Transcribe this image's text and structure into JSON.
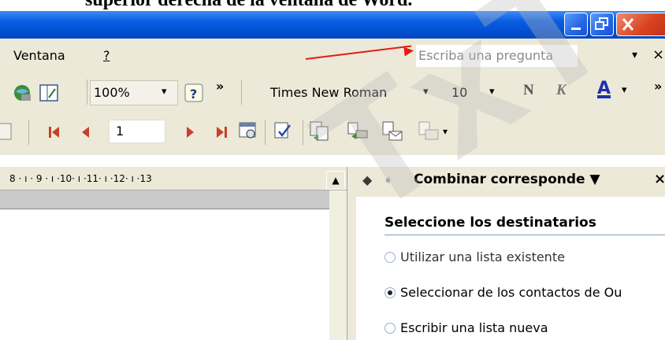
{
  "caption": {
    "text": "superior derecha de la ventana de Word."
  },
  "window": {
    "buttons": [
      {
        "name": "minimize-button",
        "glyph": "_"
      },
      {
        "name": "restore-button",
        "glyph": "❐"
      },
      {
        "name": "close-window-button",
        "glyph": "✕"
      }
    ]
  },
  "menubar": {
    "items": [
      "Ventana",
      "?"
    ],
    "ask_placeholder": "Escriba una pregunta",
    "ask_dropdown": "▾",
    "ask_close": "×",
    "arrow_color": "#e41b13"
  },
  "toolbar_standard": {
    "zoom": "100%",
    "more": "»",
    "dropdown_glyph": "▾"
  },
  "toolbar_formatting": {
    "font": "Times New Roman",
    "size": "10",
    "bold": "N",
    "italic": "K",
    "font_color_letter": "A",
    "font_color": "#1f2fb0",
    "more": "»"
  },
  "toolbar_mailmerge": {
    "record": "1",
    "dropdown_glyph": "▾"
  },
  "ruler": {
    "text": "8 · ı · 9 · ı ·10· ı ·11· ı ·12· ı ·13"
  },
  "taskpane": {
    "title": "Combinar corresponde",
    "title_dropdown": "▼",
    "close": "×",
    "section": "Seleccione los destinatarios",
    "options": [
      {
        "label": "Utilizar una lista existente",
        "selected": false
      },
      {
        "label": "Seleccionar de los contactos de Ou",
        "selected": true
      },
      {
        "label": "Escribir una lista nueva",
        "selected": false
      }
    ]
  },
  "watermark": {
    "text": "TxT"
  }
}
